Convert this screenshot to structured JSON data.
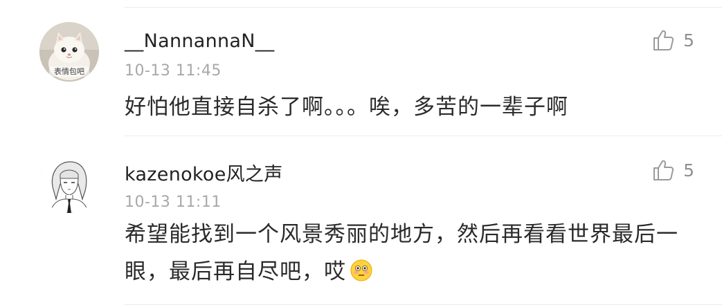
{
  "comments": [
    {
      "username": "__NannannaN__",
      "avatar_caption": "表情包吧",
      "timestamp": "10-13 11:45",
      "text": "好怕他直接自杀了啊。。。唉，多苦的一辈子啊",
      "likes": "5"
    },
    {
      "username": "kazenokoe风之声",
      "timestamp": "10-13 11:11",
      "text": "希望能找到一个风景秀丽的地方，然后再看看世界最后一眼，最后再自尽吧，哎",
      "likes": "5",
      "trailing_emoji": "flushed-face-emoji"
    }
  ],
  "icons": {
    "like": "thumbs-up-outline-icon"
  },
  "colors": {
    "username": "#222222",
    "timestamp": "#a8a8a8",
    "text": "#2a2a2a",
    "like_count": "#8f8f8f",
    "divider": "#ececec"
  }
}
